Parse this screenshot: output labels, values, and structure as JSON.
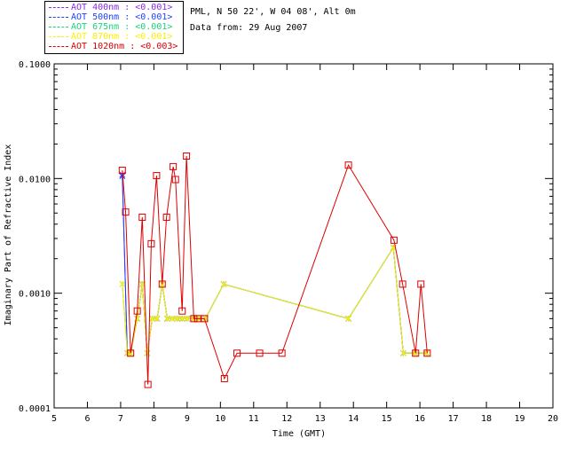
{
  "info": {
    "station": "PML, N 50 22', W 04 08', Alt 0m",
    "date": "Data from: 29 Aug 2007"
  },
  "colors": {
    "aot400": "#8a2be2",
    "aot500": "#1f3fff",
    "aot675": "#19d37c",
    "aot870": "#ffee00",
    "aot1020": "#dd0000",
    "axis": "#000000"
  },
  "chart_data": {
    "type": "line",
    "xlabel": "Time (GMT)",
    "ylabel": "Imaginary Part of Refractive Index",
    "xlim": [
      5,
      20
    ],
    "ylim": [
      0.0001,
      0.1
    ],
    "yscale": "log",
    "xticks": [
      "5",
      "6",
      "7",
      "8",
      "9",
      "10",
      "11",
      "12",
      "13",
      "14",
      "15",
      "16",
      "17",
      "18",
      "19",
      "20"
    ],
    "yticks": [
      "0.0001",
      "0.0010",
      "0.0100",
      "0.1000"
    ],
    "legend_position": "top-left",
    "series": [
      {
        "name": "AOT  400nm : <0.001>",
        "color": "#8a2be2",
        "marker": "x",
        "x": [
          7.05,
          7.2,
          7.3,
          7.5,
          7.65,
          7.8,
          7.95,
          8.1,
          8.25,
          8.4,
          8.55,
          8.7,
          8.85,
          9.0,
          9.2,
          9.35,
          9.55,
          10.1,
          13.85,
          15.2,
          15.5,
          15.85,
          16.2
        ],
        "y": [
          0.0108,
          0.0003,
          0.0003,
          0.0006,
          0.0012,
          0.0003,
          0.0006,
          0.0006,
          0.0012,
          0.0006,
          0.0006,
          0.0006,
          0.0006,
          0.0006,
          0.0006,
          0.0006,
          0.0006,
          0.0012,
          0.0006,
          0.0025,
          0.0003,
          0.0003,
          0.0003
        ]
      },
      {
        "name": "AOT  500nm : <0.001>",
        "color": "#1f3fff",
        "marker": "x",
        "x": [
          7.05,
          7.2,
          7.3,
          7.5,
          7.65,
          7.8,
          7.95,
          8.1,
          8.25,
          8.4,
          8.55,
          8.7,
          8.85,
          9.0,
          9.2,
          9.35,
          9.55,
          10.1,
          13.85,
          15.2,
          15.5,
          15.85,
          16.2
        ],
        "y": [
          0.0105,
          0.0003,
          0.0003,
          0.0006,
          0.0012,
          0.0003,
          0.0006,
          0.0006,
          0.0012,
          0.0006,
          0.0006,
          0.0006,
          0.0006,
          0.0006,
          0.0006,
          0.0006,
          0.0006,
          0.0012,
          0.0006,
          0.0025,
          0.0003,
          0.0003,
          0.0003
        ]
      },
      {
        "name": "AOT  675nm : <0.001>",
        "color": "#19d37c",
        "marker": "x",
        "x": [
          7.05,
          7.2,
          7.3,
          7.5,
          7.65,
          7.8,
          7.95,
          8.1,
          8.25,
          8.4,
          8.55,
          8.7,
          8.85,
          9.0,
          9.2,
          9.35,
          9.55,
          10.1,
          13.85,
          15.2,
          15.5,
          15.85,
          16.2
        ],
        "y": [
          0.0012,
          0.0003,
          0.0003,
          0.0006,
          0.0012,
          0.0003,
          0.0006,
          0.0006,
          0.0012,
          0.0006,
          0.0006,
          0.0006,
          0.0006,
          0.0006,
          0.0006,
          0.0006,
          0.0006,
          0.0012,
          0.0006,
          0.0025,
          0.0003,
          0.0003,
          0.0003
        ]
      },
      {
        "name": "AOT  870nm : <0.001>",
        "color": "#ffee00",
        "marker": "x",
        "x": [
          7.05,
          7.2,
          7.3,
          7.5,
          7.65,
          7.8,
          7.95,
          8.1,
          8.25,
          8.4,
          8.55,
          8.7,
          8.85,
          9.0,
          9.2,
          9.35,
          9.55,
          10.1,
          13.85,
          15.2,
          15.5,
          15.85,
          16.2
        ],
        "y": [
          0.0012,
          0.0003,
          0.0003,
          0.0006,
          0.0012,
          0.0003,
          0.0006,
          0.0006,
          0.0012,
          0.0006,
          0.0006,
          0.0006,
          0.0006,
          0.0006,
          0.0006,
          0.0006,
          0.0006,
          0.0012,
          0.0006,
          0.0025,
          0.0003,
          0.0003,
          0.0003
        ]
      },
      {
        "name": "AOT 1020nm : <0.003>",
        "color": "#dd0000",
        "marker": "square",
        "x": [
          7.05,
          7.15,
          7.3,
          7.5,
          7.65,
          7.82,
          7.92,
          8.08,
          8.25,
          8.38,
          8.58,
          8.65,
          8.85,
          8.98,
          9.2,
          9.32,
          9.52,
          10.12,
          10.5,
          11.18,
          11.85,
          13.85,
          15.22,
          15.48,
          15.87,
          16.03,
          16.22
        ],
        "y": [
          0.0118,
          0.0051,
          0.0003,
          0.0007,
          0.0046,
          0.00016,
          0.0027,
          0.0106,
          0.0012,
          0.0046,
          0.0127,
          0.0098,
          0.0007,
          0.0157,
          0.0006,
          0.0006,
          0.0006,
          0.00018,
          0.0003,
          0.0003,
          0.0003,
          0.0131,
          0.0029,
          0.0012,
          0.0003,
          0.0012,
          0.0003
        ]
      }
    ]
  }
}
